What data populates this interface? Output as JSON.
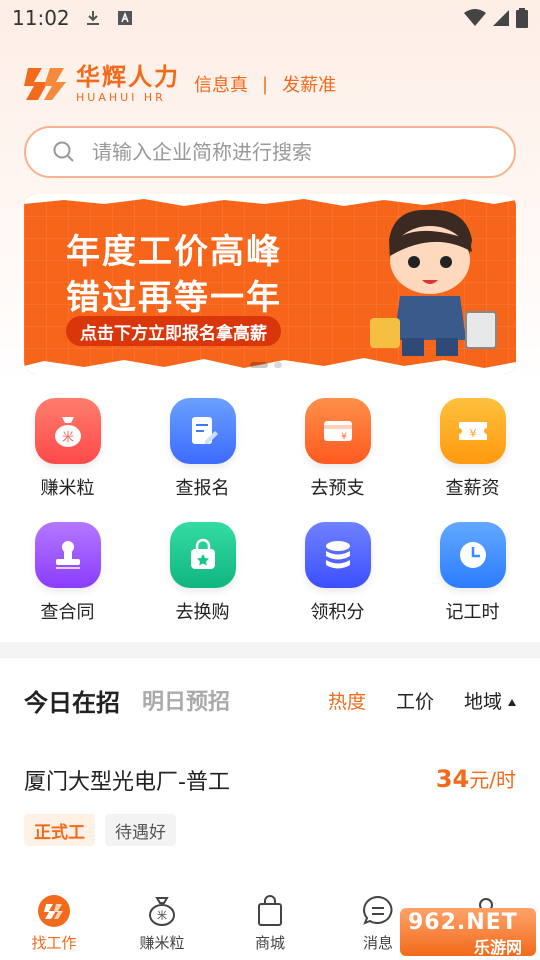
{
  "status_bar": {
    "time": "11:02"
  },
  "header": {
    "logo_cn": "华辉人力",
    "logo_en": "HUAHUI HR",
    "slogan_left": "信息真",
    "slogan_sep": "|",
    "slogan_right": "发薪准"
  },
  "search": {
    "placeholder": "请输入企业简称进行搜索"
  },
  "banner": {
    "line1": "年度工价高峰",
    "line2": "错过再等一年",
    "cta": "点击下方立即报名拿高薪"
  },
  "menu": [
    {
      "label": "赚米粒",
      "icon": "rice-bag-icon",
      "color": "#ff5b5b"
    },
    {
      "label": "查报名",
      "icon": "note-edit-icon",
      "color": "#3d7bff"
    },
    {
      "label": "去预支",
      "icon": "yuan-card-icon",
      "color": "#ff6a2a"
    },
    {
      "label": "查薪资",
      "icon": "yuan-ticket-icon",
      "color": "#ffa51a"
    },
    {
      "label": "查合同",
      "icon": "stamp-icon",
      "color": "#9b4dff"
    },
    {
      "label": "去换购",
      "icon": "shopping-bag-icon",
      "color": "#17c58e"
    },
    {
      "label": "领积分",
      "icon": "coin-stack-icon",
      "color": "#4a63ff"
    },
    {
      "label": "记工时",
      "icon": "clock-icon",
      "color": "#3a8cff"
    }
  ],
  "tabs": {
    "today": "今日在招",
    "tomorrow": "明日预招",
    "sort_hot": "热度",
    "sort_pay": "工价",
    "sort_region": "地域"
  },
  "job": {
    "title": "厦门大型光电厂-普工",
    "pay_value": "34",
    "pay_unit": "元/时",
    "tags": [
      "正式工",
      "待遇好"
    ]
  },
  "nav": [
    {
      "label": "找工作",
      "icon": "find-job-icon",
      "active": true
    },
    {
      "label": "赚米粒",
      "icon": "rice-bag-icon",
      "active": false
    },
    {
      "label": "商城",
      "icon": "shopping-bag-icon",
      "active": false
    },
    {
      "label": "消息",
      "icon": "chat-icon",
      "active": false
    },
    {
      "label": "",
      "icon": "profile-icon",
      "active": false
    }
  ],
  "watermark": {
    "top": "962.NET",
    "bottom": "乐游网"
  },
  "colors": {
    "brand": "#f26a1b",
    "banner": "#f7651a"
  }
}
